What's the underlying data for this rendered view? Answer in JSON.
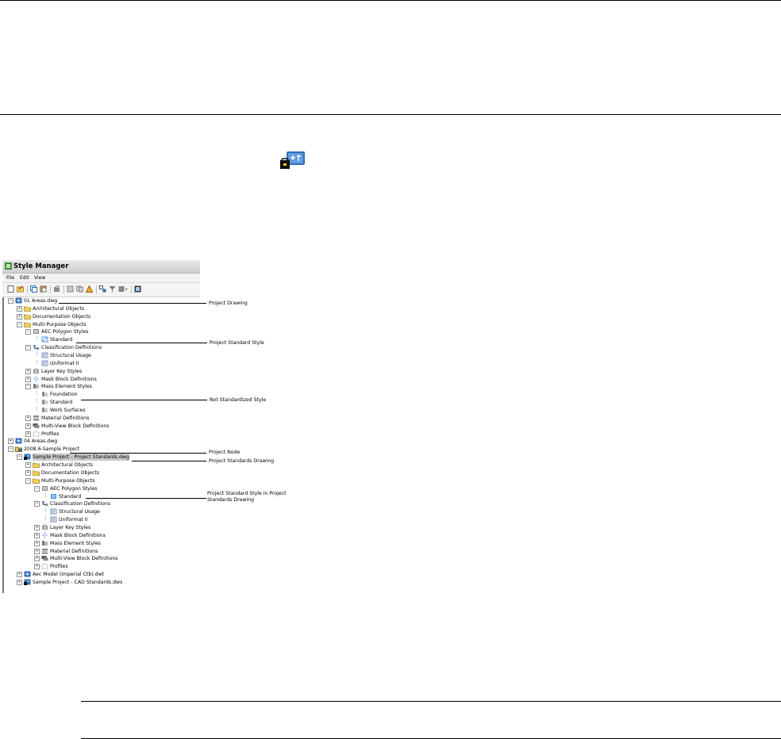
{
  "window": {
    "title": "Style Manager",
    "menus": [
      "File",
      "Edit",
      "View"
    ]
  },
  "toolbar": {
    "icons": [
      "new-drawing-icon",
      "open-drawing-icon",
      "copy-icon",
      "paste-icon",
      "edit-style-icon",
      "purge-icon",
      "synchronize-icon",
      "filter-icon",
      "toggle-view-icon",
      "inspect-icon",
      "help-icon"
    ]
  },
  "tree": [
    {
      "label": "01 Areas.dwg",
      "icon": "drawing-icon",
      "exp": "-"
    },
    {
      "label": "Architectural Objects",
      "icon": "folder-icon",
      "exp": "+"
    },
    {
      "label": "Documentation Objects",
      "icon": "folder-icon",
      "exp": "+"
    },
    {
      "label": "Multi-Purpose Objects",
      "icon": "folder-icon",
      "exp": "-"
    },
    {
      "label": "AEC Polygon Styles",
      "icon": "polygon-styles-icon",
      "exp": "-"
    },
    {
      "label": "Standard",
      "icon": "standard-style-icon",
      "exp": ""
    },
    {
      "label": "Classification Definitions",
      "icon": "classification-icon",
      "exp": "-"
    },
    {
      "label": "Structural Usage",
      "icon": "classification-item-icon",
      "exp": ""
    },
    {
      "label": "Uniformat II",
      "icon": "classification-item-icon",
      "exp": ""
    },
    {
      "label": "Layer Key Styles",
      "icon": "layer-key-icon",
      "exp": "+"
    },
    {
      "label": "Mask Block Definitions",
      "icon": "mask-block-icon",
      "exp": "+"
    },
    {
      "label": "Mass Element Styles",
      "icon": "mass-element-icon",
      "exp": "-"
    },
    {
      "label": "Foundation",
      "icon": "mass-element-style-icon",
      "exp": ""
    },
    {
      "label": "Standard",
      "icon": "mass-element-style-icon",
      "exp": ""
    },
    {
      "label": "Work Surfaces",
      "icon": "mass-element-style-icon",
      "exp": ""
    },
    {
      "label": "Material Definitions",
      "icon": "material-icon",
      "exp": "+"
    },
    {
      "label": "Multi-View Block Definitions",
      "icon": "multiview-block-icon",
      "exp": "+"
    },
    {
      "label": "Profiles",
      "icon": "profile-icon",
      "exp": "+"
    },
    {
      "label": "04 Areas.dwg",
      "icon": "drawing-icon",
      "exp": "+"
    },
    {
      "label": "2008.6-Sample Project",
      "icon": "project-icon",
      "exp": "-"
    },
    {
      "label": "Sample Project - Project Standards.dwg",
      "icon": "standards-drawing-icon",
      "exp": "-",
      "selected": true
    },
    {
      "label": "Architectural Objects",
      "icon": "folder-icon",
      "exp": "+"
    },
    {
      "label": "Documentation Objects",
      "icon": "folder-icon",
      "exp": "+"
    },
    {
      "label": "Multi-Purpose Objects",
      "icon": "folder-icon",
      "exp": "-"
    },
    {
      "label": "AEC Polygon Styles",
      "icon": "polygon-styles-icon",
      "exp": "-"
    },
    {
      "label": "Standard",
      "icon": "standard-style-blue-icon",
      "exp": ""
    },
    {
      "label": "Classification Definitions",
      "icon": "classification-icon",
      "exp": "-"
    },
    {
      "label": "Structural Usage",
      "icon": "classification-item-icon",
      "exp": ""
    },
    {
      "label": "Uniformat II",
      "icon": "classification-item-icon",
      "exp": ""
    },
    {
      "label": "Layer Key Styles",
      "icon": "layer-key-icon",
      "exp": "+"
    },
    {
      "label": "Mask Block Definitions",
      "icon": "mask-block-icon",
      "exp": "+"
    },
    {
      "label": "Mass Element Styles",
      "icon": "mass-element-icon",
      "exp": "+"
    },
    {
      "label": "Material Definitions",
      "icon": "material-icon",
      "exp": "+"
    },
    {
      "label": "Multi-View Block Definitions",
      "icon": "multiview-block-icon",
      "exp": "+"
    },
    {
      "label": "Profiles",
      "icon": "profile-icon",
      "exp": "+"
    },
    {
      "label": "Aec Model (Imperial Ctb).dwt",
      "icon": "drawing-icon",
      "exp": "+"
    },
    {
      "label": "Sample Project - CAD Standards.dws",
      "icon": "standards-drawing-icon",
      "exp": "+"
    }
  ],
  "callouts": [
    {
      "text": "Project Drawing"
    },
    {
      "text": "Project Standard Style"
    },
    {
      "text": "Not Standardized Style"
    },
    {
      "text": "Project Node"
    },
    {
      "text": "Project Standards Drawing"
    },
    {
      "text": "Project Standard Style in Project Standards Drawing"
    }
  ],
  "colors": {
    "drawing_blue": "#2f6db5",
    "folder_yellow": "#f2d25a",
    "standard_blue": "#4a90d9",
    "gray_icon": "#8c8c8c",
    "selection": "#c9c9c9"
  }
}
